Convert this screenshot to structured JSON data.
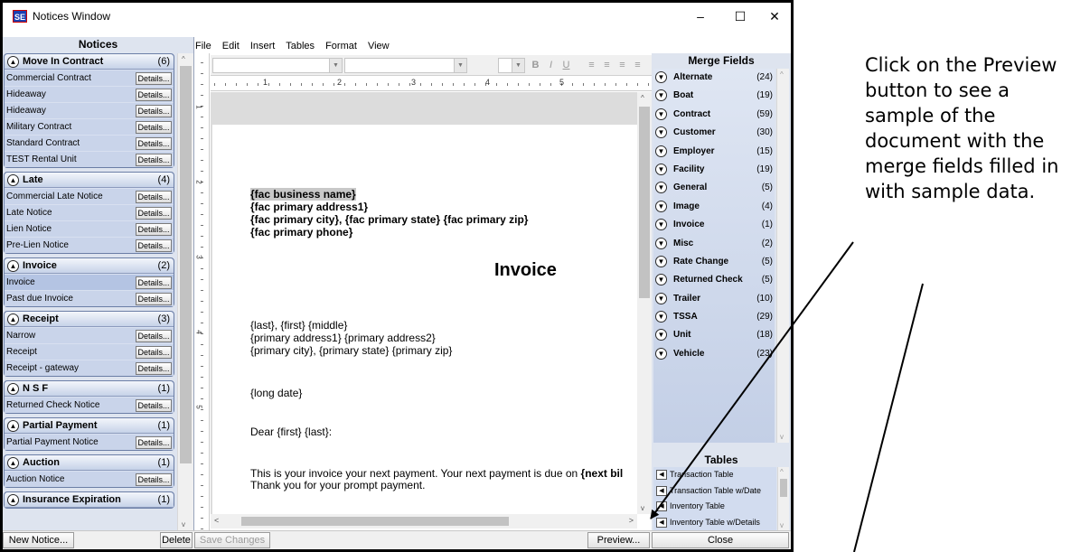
{
  "window": {
    "title": "Notices Window",
    "icon_text": "SE",
    "controls": {
      "minimize": "–",
      "maximize": "☐",
      "close": "✕"
    }
  },
  "menu": [
    "File",
    "Edit",
    "Insert",
    "Tables",
    "Format",
    "View"
  ],
  "notices": {
    "header": "Notices",
    "details_label": "Details...",
    "groups": [
      {
        "name": "Move In Contract",
        "count": "(6)",
        "items": [
          "Commercial Contract",
          "Hideaway",
          "Hideaway",
          "Military Contract",
          "Standard Contract",
          "TEST Rental Unit"
        ]
      },
      {
        "name": "Late",
        "count": "(4)",
        "items": [
          "Commercial Late Notice",
          "Late Notice",
          "Lien Notice",
          "Pre-Lien Notice"
        ]
      },
      {
        "name": "Invoice",
        "count": "(2)",
        "items": [
          "Invoice",
          "Past due Invoice"
        ]
      },
      {
        "name": "Receipt",
        "count": "(3)",
        "items": [
          "Narrow",
          "Receipt",
          "Receipt - gateway"
        ]
      },
      {
        "name": "N S F",
        "count": "(1)",
        "items": [
          "Returned Check Notice"
        ]
      },
      {
        "name": "Partial Payment",
        "count": "(1)",
        "items": [
          "Partial Payment Notice"
        ]
      },
      {
        "name": "Auction",
        "count": "(1)",
        "items": [
          "Auction Notice"
        ]
      },
      {
        "name": "Insurance Expiration",
        "count": "(1)",
        "items": []
      }
    ],
    "selected_item": "Invoice"
  },
  "toolbar": {
    "bold": "B",
    "italic": "I",
    "underline": "U"
  },
  "ruler": {
    "marks": [
      "1",
      "2",
      "3",
      "4",
      "5"
    ]
  },
  "document": {
    "lines_bold": [
      "{fac business name}",
      "{fac primary address1}",
      "{fac primary city}, {fac primary state}  {fac primary zip}",
      "{fac primary phone}"
    ],
    "title": "Invoice",
    "address_lines": [
      "{last}, {first} {middle}",
      "{primary address1} {primary address2}",
      "{primary city}, {primary state} {primary zip}"
    ],
    "date_line": "{long date}",
    "greeting": "Dear {first} {last}:",
    "body_prefix": "This is your invoice your next payment. Your next payment is due on ",
    "body_bold": "{next bil",
    "body_line2": "Thank you for your prompt payment."
  },
  "merge_fields": {
    "header": "Merge Fields",
    "items": [
      {
        "name": "Alternate",
        "count": "(24)"
      },
      {
        "name": "Boat",
        "count": "(19)"
      },
      {
        "name": "Contract",
        "count": "(59)"
      },
      {
        "name": "Customer",
        "count": "(30)"
      },
      {
        "name": "Employer",
        "count": "(15)"
      },
      {
        "name": "Facility",
        "count": "(19)"
      },
      {
        "name": "General",
        "count": "(5)"
      },
      {
        "name": "Image",
        "count": "(4)"
      },
      {
        "name": "Invoice",
        "count": "(1)"
      },
      {
        "name": "Misc",
        "count": "(2)"
      },
      {
        "name": "Rate Change",
        "count": "(5)"
      },
      {
        "name": "Returned Check",
        "count": "(5)"
      },
      {
        "name": "Trailer",
        "count": "(10)"
      },
      {
        "name": "TSSA",
        "count": "(29)"
      },
      {
        "name": "Unit",
        "count": "(18)"
      },
      {
        "name": "Vehicle",
        "count": "(23)"
      }
    ]
  },
  "tables": {
    "header": "Tables",
    "items": [
      "Transaction Table",
      "Transaction Table w/Date",
      "Inventory Table",
      "Inventory Table w/Details"
    ]
  },
  "bottom_bar": {
    "new_notice": "New Notice...",
    "delete": "Delete",
    "save_changes": "Save Changes",
    "preview": "Preview...",
    "close": "Close"
  },
  "annotation": {
    "text": "Click on the Preview button to see a sample of the document with the merge fields filled in with sample data."
  }
}
